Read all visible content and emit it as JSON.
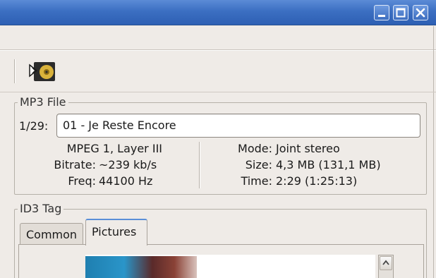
{
  "window": {
    "title": ""
  },
  "mp3_file": {
    "frame_label": "MP3 File",
    "track_position": "1/29:",
    "filename": "01 - Je Reste Encore",
    "format": "MPEG 1, Layer III",
    "bitrate_label": "Bitrate:",
    "bitrate_value": "~239 kb/s",
    "freq_label": "Freq:",
    "freq_value": "44100 Hz",
    "mode_label": "Mode:",
    "mode_value": "Joint stereo",
    "size_label": "Size:",
    "size_value": "4,3 MB (131,1 MB)",
    "time_label": "Time:",
    "time_value": "2:29 (1:25:13)"
  },
  "id3_tag": {
    "frame_label": "ID3 Tag",
    "tabs": [
      {
        "label": "Common",
        "active": false
      },
      {
        "label": "Pictures",
        "active": true
      }
    ]
  },
  "icons": {
    "minimize": "minimize-icon",
    "maximize": "maximize-icon",
    "close": "close-icon",
    "toolbar": "cd-forward-icon"
  },
  "colors": {
    "titlebar": "#3c6fc2",
    "window_bg": "#efebe7",
    "active_tab_accent": "#5a8fd8"
  }
}
